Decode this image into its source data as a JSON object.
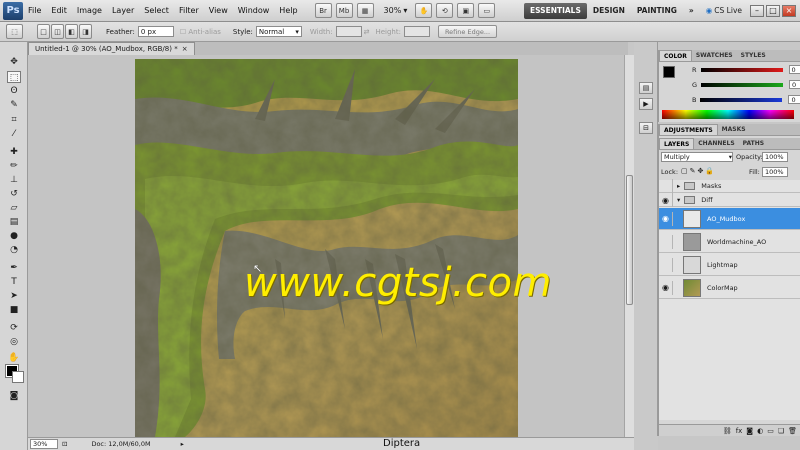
{
  "menubar": {
    "logo": "Ps",
    "items": [
      "File",
      "Edit",
      "Image",
      "Layer",
      "Select",
      "Filter",
      "View",
      "Window",
      "Help"
    ],
    "icons": [
      {
        "label": "Br"
      },
      {
        "label": "Mb"
      }
    ],
    "zoom": "30%",
    "workspaces": [
      "ESSENTIALS",
      "DESIGN",
      "PAINTING"
    ],
    "more": "»",
    "cs_live": "CS Live",
    "window_controls": [
      "–",
      "□",
      "×"
    ]
  },
  "options": {
    "feather_label": "Feather:",
    "feather_value": "0 px",
    "antialias_label": "Anti-alias",
    "style_label": "Style:",
    "style_value": "Normal",
    "width_label": "Width:",
    "height_label": "Height:",
    "refine_edge": "Refine Edge..."
  },
  "document": {
    "tab_title": "Untitled-1 @ 30% (AO_Mudbox, RGB/8) *",
    "tab_close": "×",
    "watermark": "www.cgtsj.com"
  },
  "status": {
    "zoom": "30%",
    "doc": "Doc: 12,0M/60,0M",
    "caption": "Diptera"
  },
  "panels": {
    "color": {
      "tabs": [
        "COLOR",
        "SWATCHES",
        "STYLES"
      ],
      "channels": [
        {
          "label": "R",
          "value": "0",
          "color": "#e01a1a"
        },
        {
          "label": "G",
          "value": "0",
          "color": "#1aa81a"
        },
        {
          "label": "B",
          "value": "0",
          "color": "#1a3ad8"
        }
      ]
    },
    "adjustments": {
      "tabs": [
        "ADJUSTMENTS",
        "MASKS"
      ]
    },
    "layers": {
      "tabs": [
        "LAYERS",
        "CHANNELS",
        "PATHS"
      ],
      "blend_mode": "Multiply",
      "opacity_label": "Opacity:",
      "opacity_value": "100%",
      "lock_label": "Lock:",
      "fill_label": "Fill:",
      "fill_value": "100%",
      "groups": [
        {
          "name": "Masks",
          "expanded": false
        },
        {
          "name": "Diff",
          "expanded": true
        }
      ],
      "layers": [
        {
          "name": "AO_Mudbox",
          "selected": true,
          "visible": true
        },
        {
          "name": "Worldmachine_AO",
          "selected": false,
          "visible": false
        },
        {
          "name": "Lightmap",
          "selected": false,
          "visible": false
        },
        {
          "name": "ColorMap",
          "selected": false,
          "visible": true
        }
      ],
      "bottom_icons": [
        "link-icon",
        "fx-icon",
        "mask-icon",
        "adjustment-icon",
        "folder-icon",
        "new-layer-icon",
        "trash-icon"
      ]
    }
  }
}
